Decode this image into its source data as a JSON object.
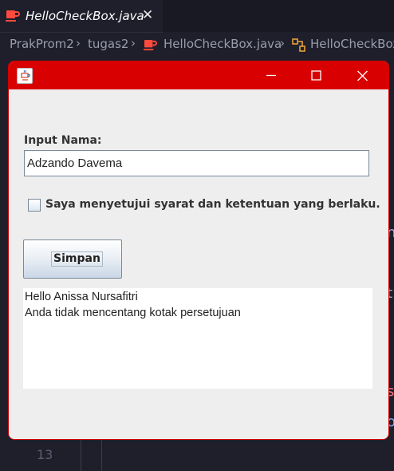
{
  "editor": {
    "active_tab": "HelloCheckBox.java",
    "breadcrumb": [
      "PrakProm2",
      "tugas2",
      "HelloCheckBox.java",
      "HelloCheckBox"
    ],
    "line_number": "13",
    "side_peek": [
      "n",
      "t",
      "s",
      "o"
    ]
  },
  "window": {
    "title": "",
    "colors": {
      "titlebar": "#d80000",
      "body": "#eeeeee"
    }
  },
  "form": {
    "name_label": "Input Nama:",
    "name_value": "Adzando Davema",
    "checkbox_label": "Saya menyetujui syarat dan ketentuan yang berlaku.",
    "checkbox_checked": false,
    "submit_label": "Simpan",
    "output_lines": [
      "Hello Anissa Nursafitri",
      "Anda tidak mencentang kotak persetujuan"
    ]
  }
}
